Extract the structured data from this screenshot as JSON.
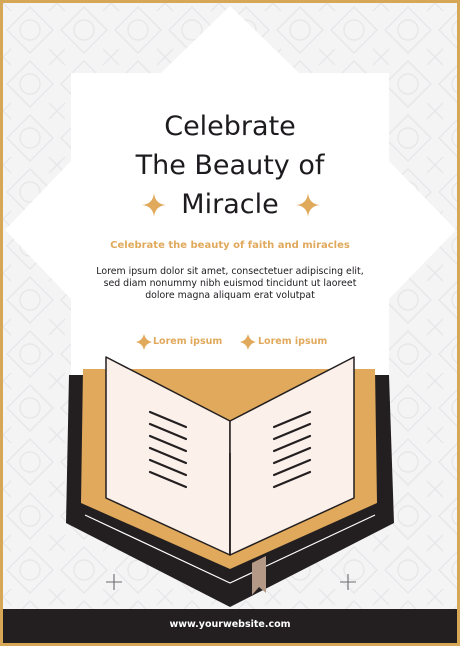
{
  "title": {
    "line1": "Celebrate",
    "line2": "The Beauty of",
    "line3": "Miracle"
  },
  "subtitle": "Celebrate the beauty of faith and miracles",
  "body": "Lorem ipsum dolor sit amet, consectetuer adipiscing elit, sed diam nonummy nibh euismod tincidunt ut laoreet dolore magna aliquam erat volutpat",
  "labels": [
    "Lorem ipsum",
    "Lorem ipsum"
  ],
  "footer": {
    "website": "www.yourwebsite.com"
  },
  "colors": {
    "border": "#d7a758",
    "accent": "#e0a95c",
    "dark": "#231f20",
    "page": "#fbf1ea",
    "background": "#f4f4f5"
  },
  "icons": [
    "sparkle-icon",
    "open-book-illustration"
  ]
}
